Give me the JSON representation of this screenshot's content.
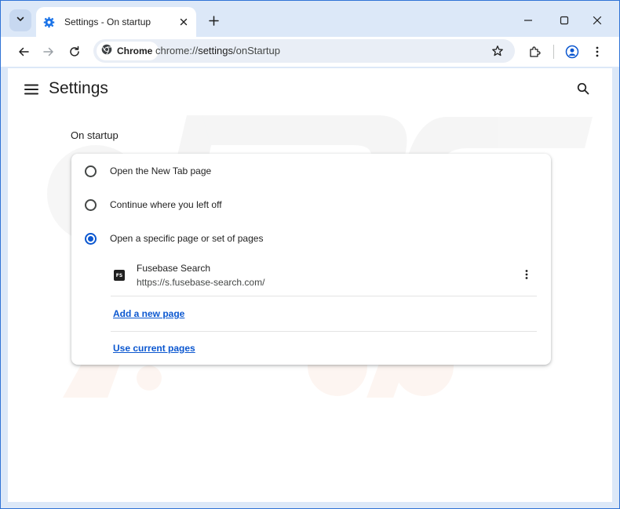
{
  "window": {
    "tab_title": "Settings - On startup",
    "icons": {
      "tab_dropdown": "chevron-down-icon",
      "favicon": "gear-icon",
      "tab_close": "close-icon",
      "new_tab": "plus-icon",
      "minimize": "minimize-icon",
      "maximize": "maximize-icon",
      "close": "close-icon"
    }
  },
  "toolbar": {
    "chip_label": "Chrome",
    "url_scheme": "chrome://",
    "url_host": "settings",
    "url_path": "/onStartup",
    "icons": [
      "back-arrow-icon",
      "forward-arrow-icon",
      "reload-icon",
      "star-icon",
      "extensions-icon",
      "profile-icon",
      "more-vert-icon"
    ]
  },
  "settings": {
    "title": "Settings",
    "section_title": "On startup",
    "options": [
      {
        "label": "Open the New Tab page",
        "checked": false
      },
      {
        "label": "Continue where you left off",
        "checked": false
      },
      {
        "label": "Open a specific page or set of pages",
        "checked": true
      }
    ],
    "pages": [
      {
        "favicon_text": "FS",
        "name": "Fusebase Search",
        "url": "https://s.fusebase-search.com/"
      }
    ],
    "add_new_page": "Add a new page",
    "use_current_pages": "Use current pages"
  },
  "colors": {
    "accent": "#0b57d0",
    "frame": "#dce8f8",
    "border": "#2f73d6"
  }
}
